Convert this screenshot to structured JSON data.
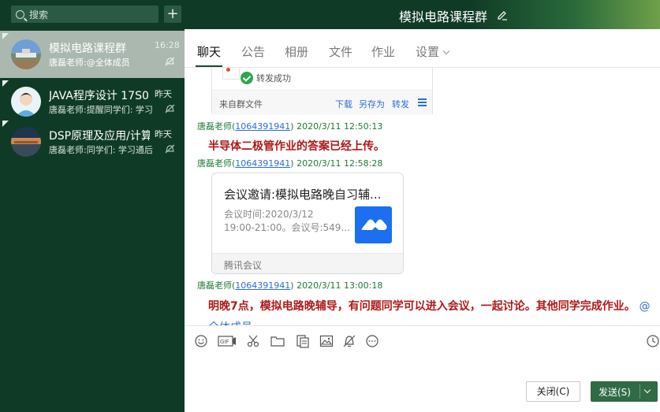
{
  "sidebar": {
    "search_placeholder": "搜索",
    "add_label": "+",
    "conversations": [
      {
        "title": "模拟电路课程群",
        "time": "16:28",
        "preview": "唐磊老师:@全体成员"
      },
      {
        "title": "JAVA程序设计 17S0",
        "time": "昨天",
        "preview": "唐磊老师:提醒同学们: 学习"
      },
      {
        "title": "DSP原理及应用/计算",
        "time": "昨天",
        "preview": "唐磊老师:同学们: 学习通后"
      }
    ]
  },
  "header": {
    "title": "模拟电路课程群"
  },
  "tabs": [
    {
      "label": "聊天"
    },
    {
      "label": "公告"
    },
    {
      "label": "相册"
    },
    {
      "label": "文件"
    },
    {
      "label": "作业"
    },
    {
      "label": "设置"
    }
  ],
  "messages": {
    "file_card": {
      "status": "转发成功",
      "from": "来自群文件",
      "download": "下载",
      "save_as": "另存为",
      "forward": "转发"
    },
    "msg1": {
      "sender": "唐磊老师(",
      "qq": "1064391941",
      "time": ") 2020/3/11 12:50:13",
      "text": "半导体二极管作业的答案已经上传。"
    },
    "msg2": {
      "sender": "唐磊老师(",
      "qq": "1064391941",
      "time": ") 2020/3/11 12:58:28"
    },
    "meeting": {
      "title": "会议邀请:模拟电路晚自习辅...",
      "time_line1": "会议时间:2020/3/12",
      "time_line2": "19:00-21:00。会议号:549...",
      "footer": "腾讯会议"
    },
    "msg3": {
      "sender": "唐磊老师(",
      "qq": "1064391941",
      "time": ") 2020/3/11 13:00:18",
      "text": "明晚7点，模拟电路晚辅导，有问题同学可以进入会议，一起讨论。其他同学完成作业。",
      "mention": "@全体成员"
    }
  },
  "input": {
    "close_label": "关闭(C)",
    "send_label": "发送(S)"
  },
  "colors": {
    "sidebar_bg": "#0f3b26",
    "active_conv": "#aab8b0",
    "meta_green": "#1c7a34",
    "alert_red": "#b01818",
    "link_blue": "#2a6fd1",
    "send_green": "#2f6b45"
  },
  "icons": [
    "search-icon",
    "plus-icon",
    "edit-icon",
    "mute-icon",
    "check-icon",
    "menu-icon",
    "tencent-meeting-icon",
    "emoji-icon",
    "gif-icon",
    "scissors-icon",
    "folder-icon",
    "doc-icon",
    "image-icon",
    "bell-off-icon",
    "more-icon",
    "clock-icon",
    "chevron-down-icon"
  ]
}
